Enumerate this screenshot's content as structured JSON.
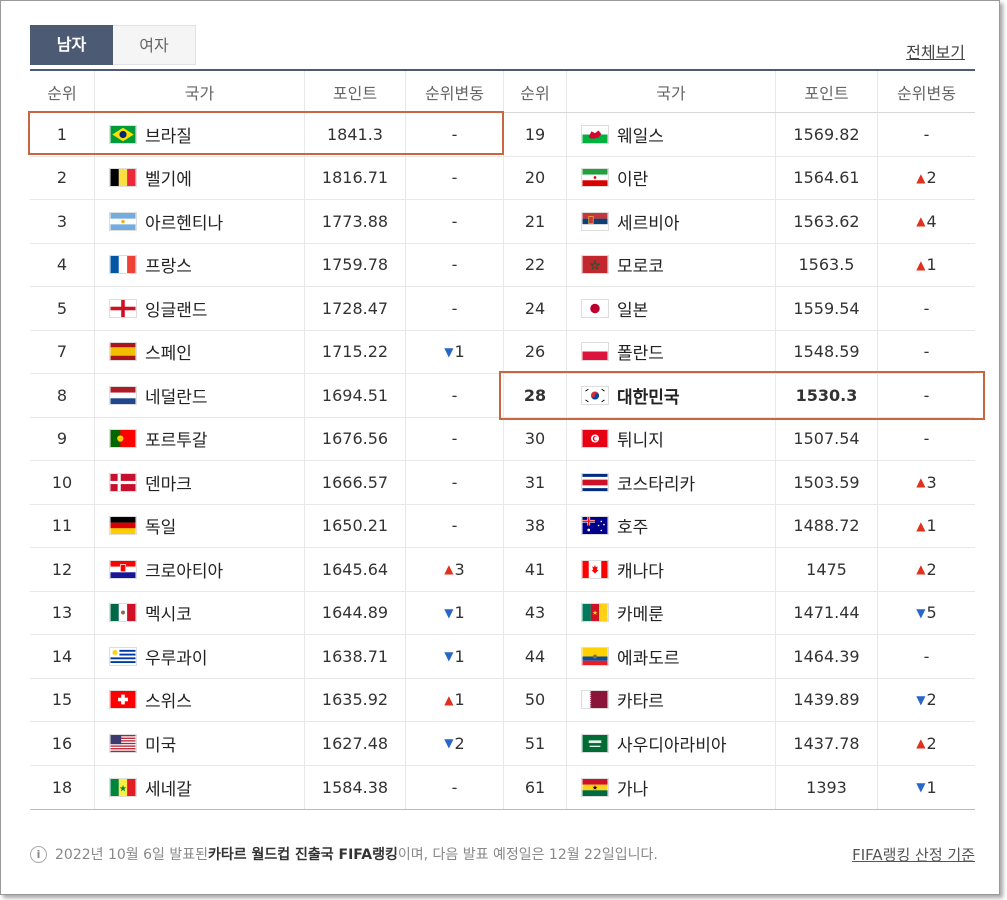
{
  "tabs": [
    {
      "label": "남자",
      "active": true
    },
    {
      "label": "여자",
      "active": false
    }
  ],
  "view_all": "전체보기",
  "headers": {
    "rank": "순위",
    "country": "국가",
    "points": "포인트",
    "change": "순위변동"
  },
  "left": [
    {
      "rank": "1",
      "country": "브라질",
      "points": "1841.3",
      "change": "-",
      "dir": "none",
      "flag": "brazil"
    },
    {
      "rank": "2",
      "country": "벨기에",
      "points": "1816.71",
      "change": "-",
      "dir": "none",
      "flag": "belgium"
    },
    {
      "rank": "3",
      "country": "아르헨티나",
      "points": "1773.88",
      "change": "-",
      "dir": "none",
      "flag": "argentina"
    },
    {
      "rank": "4",
      "country": "프랑스",
      "points": "1759.78",
      "change": "-",
      "dir": "none",
      "flag": "france"
    },
    {
      "rank": "5",
      "country": "잉글랜드",
      "points": "1728.47",
      "change": "-",
      "dir": "none",
      "flag": "england"
    },
    {
      "rank": "7",
      "country": "스페인",
      "points": "1715.22",
      "change": "1",
      "dir": "down",
      "flag": "spain"
    },
    {
      "rank": "8",
      "country": "네덜란드",
      "points": "1694.51",
      "change": "-",
      "dir": "none",
      "flag": "netherlands"
    },
    {
      "rank": "9",
      "country": "포르투갈",
      "points": "1676.56",
      "change": "-",
      "dir": "none",
      "flag": "portugal"
    },
    {
      "rank": "10",
      "country": "덴마크",
      "points": "1666.57",
      "change": "-",
      "dir": "none",
      "flag": "denmark"
    },
    {
      "rank": "11",
      "country": "독일",
      "points": "1650.21",
      "change": "-",
      "dir": "none",
      "flag": "germany"
    },
    {
      "rank": "12",
      "country": "크로아티아",
      "points": "1645.64",
      "change": "3",
      "dir": "up",
      "flag": "croatia"
    },
    {
      "rank": "13",
      "country": "멕시코",
      "points": "1644.89",
      "change": "1",
      "dir": "down",
      "flag": "mexico"
    },
    {
      "rank": "14",
      "country": "우루과이",
      "points": "1638.71",
      "change": "1",
      "dir": "down",
      "flag": "uruguay"
    },
    {
      "rank": "15",
      "country": "스위스",
      "points": "1635.92",
      "change": "1",
      "dir": "up",
      "flag": "switzerland"
    },
    {
      "rank": "16",
      "country": "미국",
      "points": "1627.48",
      "change": "2",
      "dir": "down",
      "flag": "usa"
    },
    {
      "rank": "18",
      "country": "세네갈",
      "points": "1584.38",
      "change": "-",
      "dir": "none",
      "flag": "senegal"
    }
  ],
  "right": [
    {
      "rank": "19",
      "country": "웨일스",
      "points": "1569.82",
      "change": "-",
      "dir": "none",
      "flag": "wales"
    },
    {
      "rank": "20",
      "country": "이란",
      "points": "1564.61",
      "change": "2",
      "dir": "up",
      "flag": "iran"
    },
    {
      "rank": "21",
      "country": "세르비아",
      "points": "1563.62",
      "change": "4",
      "dir": "up",
      "flag": "serbia"
    },
    {
      "rank": "22",
      "country": "모로코",
      "points": "1563.5",
      "change": "1",
      "dir": "up",
      "flag": "morocco"
    },
    {
      "rank": "24",
      "country": "일본",
      "points": "1559.54",
      "change": "-",
      "dir": "none",
      "flag": "japan"
    },
    {
      "rank": "26",
      "country": "폴란드",
      "points": "1548.59",
      "change": "-",
      "dir": "none",
      "flag": "poland"
    },
    {
      "rank": "28",
      "country": "대한민국",
      "points": "1530.3",
      "change": "-",
      "dir": "none",
      "flag": "korea",
      "bold": true
    },
    {
      "rank": "30",
      "country": "튀니지",
      "points": "1507.54",
      "change": "-",
      "dir": "none",
      "flag": "tunisia"
    },
    {
      "rank": "31",
      "country": "코스타리카",
      "points": "1503.59",
      "change": "3",
      "dir": "up",
      "flag": "costarica"
    },
    {
      "rank": "38",
      "country": "호주",
      "points": "1488.72",
      "change": "1",
      "dir": "up",
      "flag": "australia"
    },
    {
      "rank": "41",
      "country": "캐나다",
      "points": "1475",
      "change": "2",
      "dir": "up",
      "flag": "canada"
    },
    {
      "rank": "43",
      "country": "카메룬",
      "points": "1471.44",
      "change": "5",
      "dir": "down",
      "flag": "cameroon"
    },
    {
      "rank": "44",
      "country": "에콰도르",
      "points": "1464.39",
      "change": "-",
      "dir": "none",
      "flag": "ecuador"
    },
    {
      "rank": "50",
      "country": "카타르",
      "points": "1439.89",
      "change": "2",
      "dir": "down",
      "flag": "qatar"
    },
    {
      "rank": "51",
      "country": "사우디아라비아",
      "points": "1437.78",
      "change": "2",
      "dir": "up",
      "flag": "saudi"
    },
    {
      "rank": "61",
      "country": "가나",
      "points": "1393",
      "change": "1",
      "dir": "down",
      "flag": "ghana"
    }
  ],
  "footer": {
    "prefix": "2022년 10월 6일 발표된 ",
    "highlight": "카타르 월드컵 진출국 FIFA랭킹",
    "suffix": "이며, 다음 발표 예정일은 12월 22일입니다.",
    "criteria": "FIFA랭킹 산정 기준"
  }
}
